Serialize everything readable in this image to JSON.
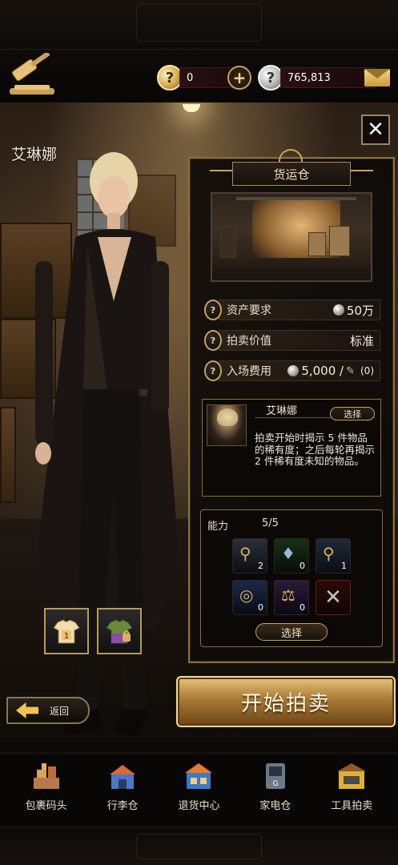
{
  "header": {
    "gold_amount": "0",
    "silver_amount": "765,813",
    "plus_label": "+"
  },
  "character": {
    "name": "艾琳娜"
  },
  "panel": {
    "title": "货运仓",
    "stats": [
      {
        "label": "资产要求",
        "value": "50万"
      },
      {
        "label": "拍卖价值",
        "value": "标准"
      },
      {
        "label": "入场费用",
        "value": "5,000 /",
        "extra": "(0)"
      }
    ],
    "host": {
      "name": "艾琳娜",
      "select_label": "选择",
      "description": "拍卖开始时揭示 5 件物品的稀有度；之后每轮再揭示 2 件稀有度未知的物品。"
    },
    "abilities": {
      "label": "能力",
      "count": "5/5",
      "slots": [
        {
          "icon": "magnifier-gold-icon",
          "count": "2"
        },
        {
          "icon": "gem-lamp-icon",
          "count": "0"
        },
        {
          "icon": "magnifier-blue-icon",
          "count": "1"
        },
        {
          "icon": "ring-icon",
          "count": "0"
        },
        {
          "icon": "scales-icon",
          "count": "0"
        },
        {
          "icon": "close-icon",
          "count": ""
        }
      ],
      "select_label": "选择"
    }
  },
  "outfits": [
    {
      "icon": "shirt-icon",
      "badge": "1"
    },
    {
      "icon": "locked-shirt-icon",
      "badge": ""
    }
  ],
  "actions": {
    "start_label": "开始拍卖",
    "back_label": "返回"
  },
  "nav": [
    {
      "label": "包裹码头",
      "icon": "dock-icon"
    },
    {
      "label": "行李仓",
      "icon": "luggage-icon"
    },
    {
      "label": "退货中心",
      "icon": "return-center-icon"
    },
    {
      "label": "家电仓",
      "icon": "appliance-icon"
    },
    {
      "label": "工具拍卖",
      "icon": "tool-auction-icon"
    }
  ]
}
